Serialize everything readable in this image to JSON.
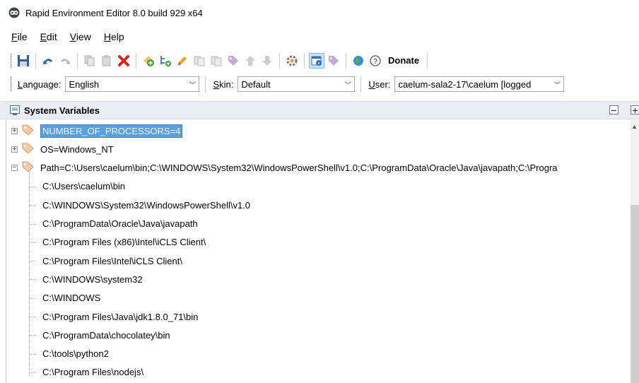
{
  "window": {
    "title": "Rapid Environment Editor 8.0 build 929 x64"
  },
  "menu": [
    {
      "label": "File",
      "key": "F",
      "rest": "ile"
    },
    {
      "label": "Edit",
      "key": "E",
      "rest": "dit"
    },
    {
      "label": "View",
      "key": "V",
      "rest": "iew"
    },
    {
      "label": "Help",
      "key": "H",
      "rest": "elp"
    }
  ],
  "toolbar": {
    "donate_label": "Donate"
  },
  "options": {
    "language_key": "L",
    "language_rest": "anguage:",
    "language_value": "English",
    "skin_key": "S",
    "skin_rest": "kin:",
    "skin_value": "Default",
    "user_key": "U",
    "user_rest": "ser:",
    "user_value": "caelum-sala2-17\\caelum [logged"
  },
  "panel": {
    "title": "System Variables"
  },
  "tree": {
    "variables": [
      {
        "text": "NUMBER_OF_PROCESSORS=4",
        "expander": "+",
        "selected": true
      },
      {
        "text": "OS=Windows_NT",
        "expander": "+",
        "selected": false
      },
      {
        "text": "Path=C:\\Users\\caelum\\bin;C:\\WINDOWS\\System32\\WindowsPowerShell\\v1.0;C:\\ProgramData\\Oracle\\Java\\javapath;C:\\Progra",
        "expander": "−",
        "selected": false
      }
    ],
    "path_entries": [
      "C:\\Users\\caelum\\bin",
      "C:\\WINDOWS\\System32\\WindowsPowerShell\\v1.0",
      "C:\\ProgramData\\Oracle\\Java\\javapath",
      "C:\\Program Files (x86)\\Intel\\iCLS Client\\",
      "C:\\Program Files\\Intel\\iCLS Client\\",
      "C:\\WINDOWS\\system32",
      "C:\\WINDOWS",
      "C:\\Program Files\\Java\\jdk1.8.0_71\\bin",
      "C:\\ProgramData\\chocolatey\\bin",
      "C:\\tools\\python2",
      "C:\\Program Files\\nodejs\\"
    ]
  },
  "colors": {
    "selection": "#5a9fe0",
    "panel_header": "#e9edf2",
    "tag_icon": "#e8a27a"
  }
}
